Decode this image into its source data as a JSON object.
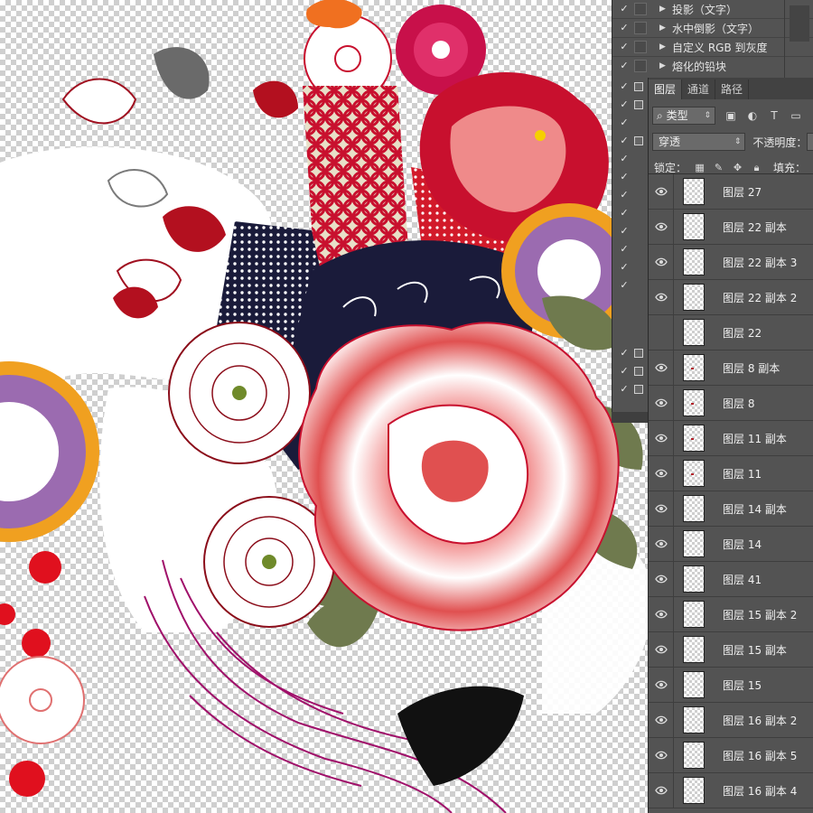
{
  "actions": {
    "items": [
      {
        "label": "投影（文字）",
        "checked": true
      },
      {
        "label": "水中倒影（文字）",
        "checked": true
      },
      {
        "label": "自定义 RGB 到灰度",
        "checked": true
      },
      {
        "label": "熔化的铅块",
        "checked": true
      }
    ]
  },
  "layers_panel": {
    "tabs": [
      {
        "label": "图层",
        "active": true
      },
      {
        "label": "通道",
        "active": false
      },
      {
        "label": "路径",
        "active": false
      }
    ],
    "filter": {
      "label": "类型",
      "icons": [
        "image-filter-icon",
        "adjustment-filter-icon",
        "type-filter-icon",
        "shape-filter-icon"
      ]
    },
    "blend_mode": "穿透",
    "opacity_label": "不透明度：",
    "lock_label": "锁定：",
    "fill_label": "填充：",
    "layers": [
      {
        "name": "图层 27",
        "visible": true
      },
      {
        "name": "图层 22 副本",
        "visible": true
      },
      {
        "name": "图层 22 副本 3",
        "visible": true
      },
      {
        "name": "图层 22 副本 2",
        "visible": true
      },
      {
        "name": "图层 22",
        "visible": false
      },
      {
        "name": "图层 8 副本",
        "visible": true
      },
      {
        "name": "图层 8",
        "visible": true
      },
      {
        "name": "图层 11 副本",
        "visible": true
      },
      {
        "name": "图层 11",
        "visible": true
      },
      {
        "name": "图层 14 副本",
        "visible": true
      },
      {
        "name": "图层 14",
        "visible": true
      },
      {
        "name": "图层 41",
        "visible": true
      },
      {
        "name": "图层 15 副本 2",
        "visible": true
      },
      {
        "name": "图层 15 副本",
        "visible": true
      },
      {
        "name": "图层 15",
        "visible": true
      },
      {
        "name": "图层 16 副本 2",
        "visible": true
      },
      {
        "name": "图层 16 副本 5",
        "visible": true
      },
      {
        "name": "图层 16 副本 4",
        "visible": true
      }
    ]
  },
  "colors": {
    "panel_bg": "#535353",
    "panel_dark": "#424242",
    "pattern_red": "#c8102e",
    "pattern_dark_red": "#8b0d1a",
    "pattern_navy": "#1a1b3a",
    "pattern_purple": "#9b6bb0",
    "pattern_gold": "#f0a020",
    "pattern_green": "#6f7a4e"
  }
}
